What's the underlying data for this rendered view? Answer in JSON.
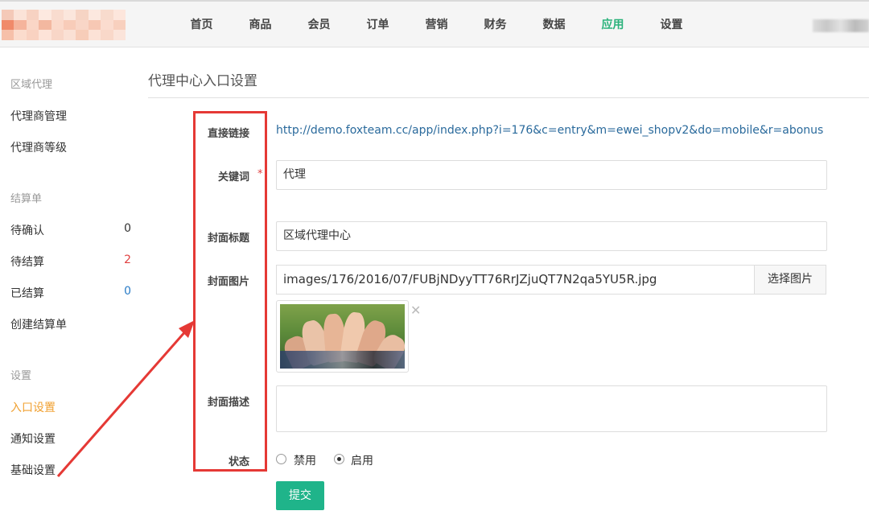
{
  "nav": {
    "items": [
      "首页",
      "商品",
      "会员",
      "订单",
      "营销",
      "财务",
      "数据",
      "应用",
      "设置"
    ],
    "active_index": 7
  },
  "sidebar": {
    "sections": [
      {
        "title": "区域代理",
        "items": [
          {
            "label": "代理商管理"
          },
          {
            "label": "代理商等级"
          }
        ]
      },
      {
        "title": "结算单",
        "items": [
          {
            "label": "待确认",
            "count": "0"
          },
          {
            "label": "待结算",
            "count": "2"
          },
          {
            "label": "已结算",
            "count": "0"
          },
          {
            "label": "创建结算单"
          }
        ]
      },
      {
        "title": "设置",
        "items": [
          {
            "label": "入口设置"
          },
          {
            "label": "通知设置"
          },
          {
            "label": "基础设置"
          }
        ]
      }
    ]
  },
  "page": {
    "title": "代理中心入口设置"
  },
  "form": {
    "link_label": "直接链接",
    "link_value": "http://demo.foxteam.cc/app/index.php?i=176&c=entry&m=ewei_shopv2&do=mobile&r=abonus",
    "keyword_label": "关键词",
    "keyword_required": "*",
    "keyword_value": "代理",
    "cover_title_label": "封面标题",
    "cover_title_value": "区域代理中心",
    "cover_image_label": "封面图片",
    "cover_image_value": "images/176/2016/07/FUBjNDyyTT76RrJZjuQT7N2qa5YU5R.jpg",
    "pick_image_label": "选择图片",
    "remove_glyph": "✕",
    "cover_desc_label": "封面描述",
    "cover_desc_value": "",
    "status_label": "状态",
    "status_options": [
      "禁用",
      "启用"
    ],
    "status_selected": "启用",
    "submit_label": "提交"
  },
  "colors": {
    "accent": "#1fb48a",
    "nav_active": "#2ab27b",
    "sidebar_active": "#f0a030",
    "annotation": "#e53935",
    "link": "#2a6a9c"
  }
}
